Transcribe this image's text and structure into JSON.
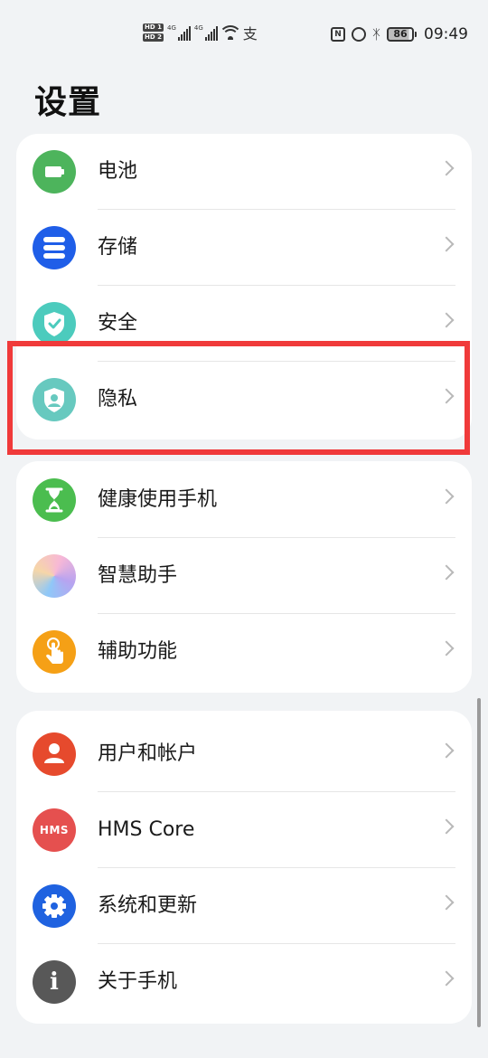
{
  "status_bar": {
    "sim1_badge": "HD 1",
    "sim2_badge": "HD 2",
    "net1": "4G",
    "net2": "4G",
    "extra_icon": "支",
    "nfc_icon": "N",
    "battery_level": "86",
    "time": "09:49"
  },
  "page": {
    "title": "设置"
  },
  "groups": [
    {
      "items": [
        {
          "label": "电池",
          "icon": "battery-icon",
          "color": "#4db45c"
        },
        {
          "label": "存储",
          "icon": "storage-icon",
          "color": "#1f5ee8"
        },
        {
          "label": "安全",
          "icon": "shield-check-icon",
          "color": "#4ccbbd"
        },
        {
          "label": "隐私",
          "icon": "privacy-shield-icon",
          "color": "#67c9bf"
        }
      ]
    },
    {
      "items": [
        {
          "label": "健康使用手机",
          "icon": "hourglass-icon",
          "color": "#4bbd4f"
        },
        {
          "label": "智慧助手",
          "icon": "assistant-icon",
          "color": "#b8a3f0"
        },
        {
          "label": "辅助功能",
          "icon": "hand-touch-icon",
          "color": "#f5a016"
        }
      ]
    },
    {
      "items": [
        {
          "label": "用户和帐户",
          "icon": "user-icon",
          "color": "#e64a2d"
        },
        {
          "label": "HMS Core",
          "icon": "hms-icon",
          "icon_text": "HMS",
          "color": "#e5504f"
        },
        {
          "label": "系统和更新",
          "icon": "gear-icon",
          "color": "#1f62e0"
        },
        {
          "label": "关于手机",
          "icon": "info-icon",
          "icon_text": "i",
          "color": "#585858"
        }
      ]
    }
  ],
  "highlight_color": "#f03a3a"
}
